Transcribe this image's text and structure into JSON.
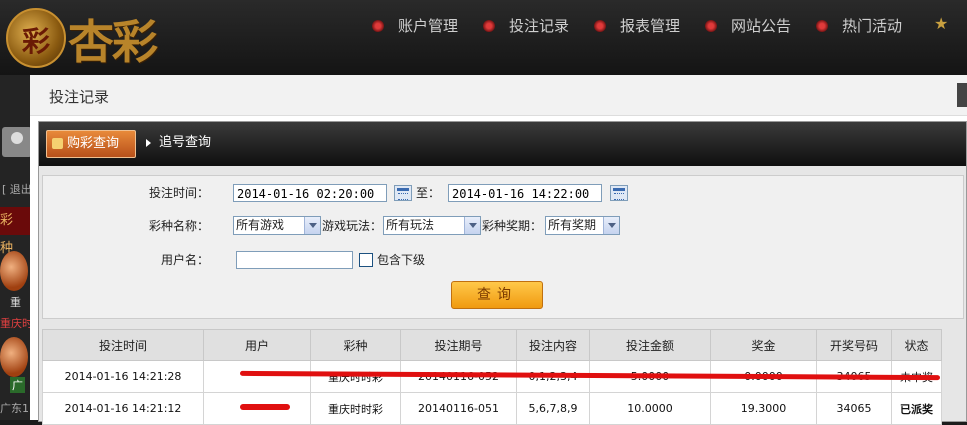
{
  "brand": {
    "emblem": "彩",
    "name": "杏彩"
  },
  "nav": {
    "items": [
      "账户管理",
      "投注记录",
      "报表管理",
      "网站公告",
      "热门活动"
    ]
  },
  "sidebar": {
    "logout": "[ 退出",
    "section": "彩 种",
    "game_label": "重",
    "red_label": "重庆时",
    "badge": "广",
    "region": "广东1"
  },
  "dialog": {
    "title": "投注记录"
  },
  "tabs": {
    "active": "购彩查询",
    "second": "追号查询"
  },
  "filters": {
    "time_label": "投注时间：",
    "start_time": "2014-01-16 02:20:00",
    "to_label": "至：",
    "end_time": "2014-01-16 14:22:00",
    "game_label": "彩种名称：",
    "game_value": "所有游戏",
    "play_label": "游戏玩法：",
    "play_value": "所有玩法",
    "period_label": "彩种奖期：",
    "period_value": "所有奖期",
    "user_label": "用户名：",
    "user_value": "",
    "include_sub_label": "包含下级",
    "query_button": "查询"
  },
  "table": {
    "headers": [
      "投注时间",
      "用户",
      "彩种",
      "投注期号",
      "投注内容",
      "投注金额",
      "奖金",
      "开奖号码",
      "状态"
    ],
    "rows": [
      [
        "2014-01-16 14:21:28",
        "",
        "重庆时时彩",
        "20140116-052",
        "0,1,2,3,4",
        "5.0000",
        "0.0000",
        "34065",
        "未中奖"
      ],
      [
        "2014-01-16 14:21:12",
        "",
        "重庆时时彩",
        "20140116-051",
        "5,6,7,8,9",
        "10.0000",
        "19.3000",
        "34065",
        "已派奖"
      ]
    ]
  },
  "colors": {
    "accent": "#f09a10",
    "status_paid": "#1a8a1a",
    "redaction": "#e01010"
  }
}
